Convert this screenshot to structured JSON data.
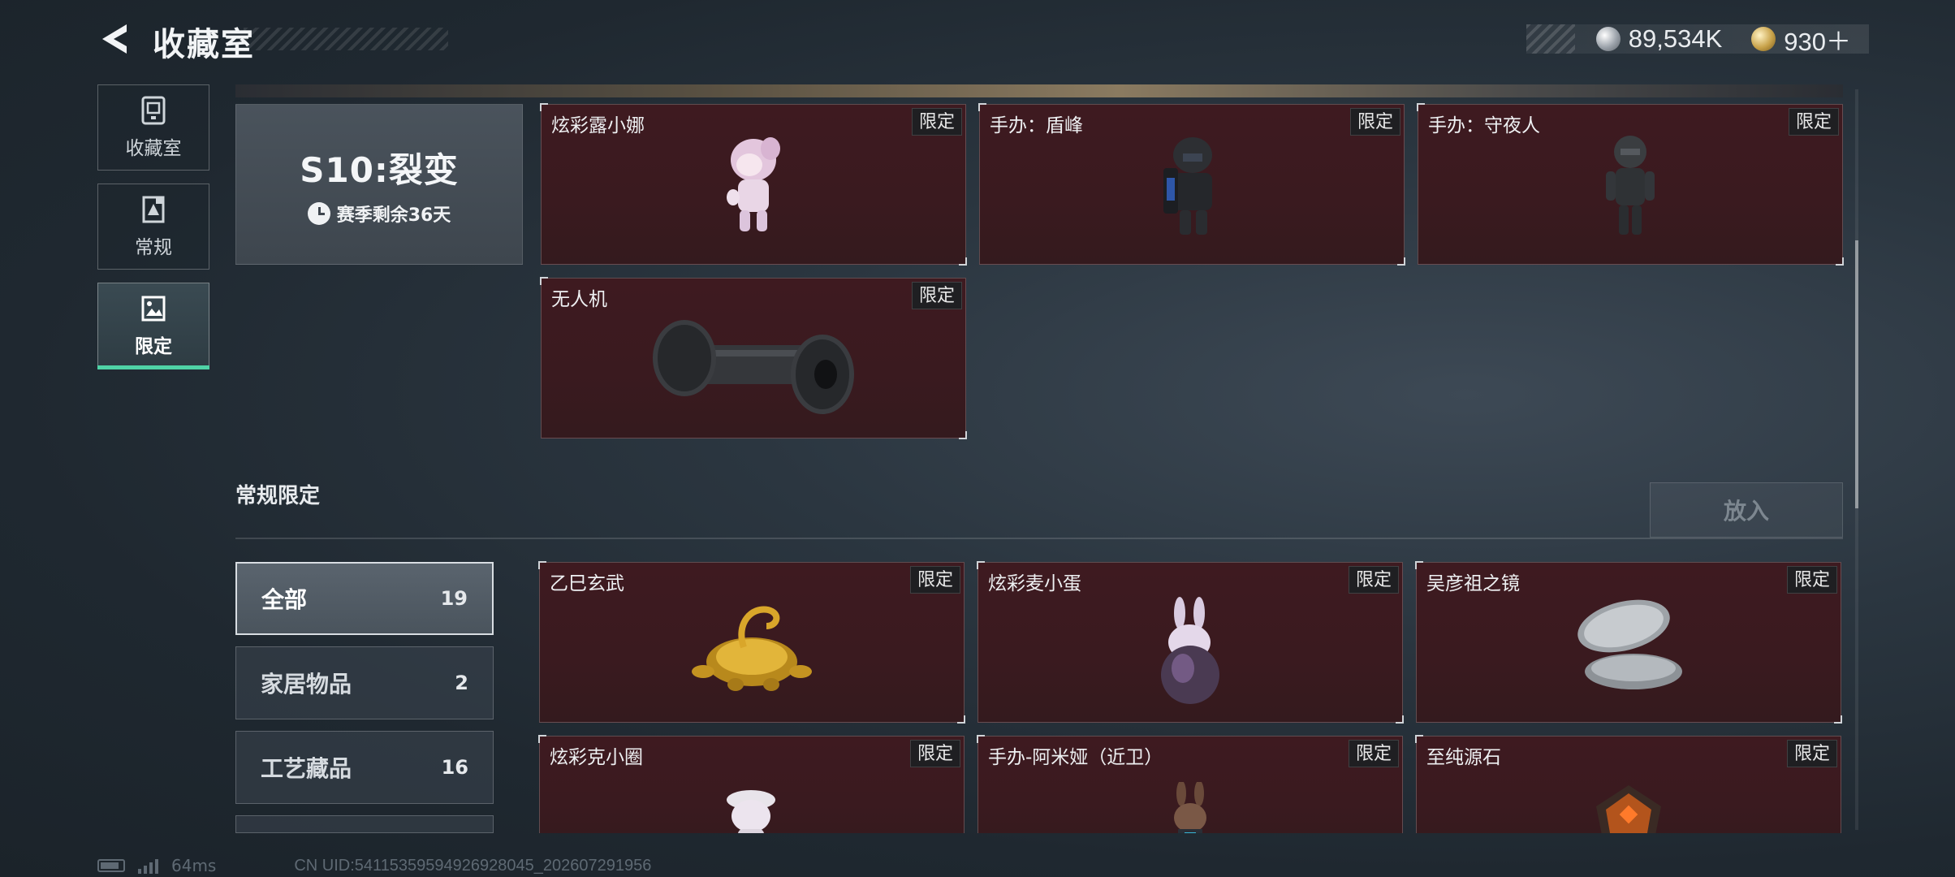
{
  "header": {
    "title": "收藏室",
    "currency": [
      {
        "icon": "silver-coin-icon",
        "value": "89,534K"
      },
      {
        "icon": "gold-coin-icon",
        "value": "930＋"
      }
    ]
  },
  "nav": {
    "items": [
      {
        "label": "收藏室",
        "icon": "collection-box-icon",
        "active": false
      },
      {
        "label": "常规",
        "icon": "regular-doc-icon",
        "active": false
      },
      {
        "label": "限定",
        "icon": "limited-image-icon",
        "active": true
      }
    ]
  },
  "season": {
    "name": "S10:裂变",
    "remaining": "赛季剩余36天"
  },
  "season_items": [
    {
      "name": "炫彩露小娜",
      "tag": "限定",
      "art": "figure-pink-girl"
    },
    {
      "name": "手办：盾峰",
      "tag": "限定",
      "art": "figure-armored-soldier"
    },
    {
      "name": "手办：守夜人",
      "tag": "限定",
      "art": "figure-dark-soldier"
    },
    {
      "name": "无人机",
      "tag": "限定",
      "art": "drone-roller"
    }
  ],
  "section": {
    "title": "常规限定",
    "put_button": "放入"
  },
  "categories": [
    {
      "label": "全部",
      "count": "19",
      "active": true
    },
    {
      "label": "家居物品",
      "count": "2",
      "active": false
    },
    {
      "label": "工艺藏品",
      "count": "16",
      "active": false
    }
  ],
  "regular_items": [
    {
      "name": "乙巳玄武",
      "tag": "限定",
      "art": "golden-tortoise-snake"
    },
    {
      "name": "炫彩麦小蛋",
      "tag": "限定",
      "art": "bunny-egg"
    },
    {
      "name": "吴彦祖之镜",
      "tag": "限定",
      "art": "compact-mirror"
    },
    {
      "name": "炫彩克小圈",
      "tag": "限定",
      "art": "figure-white-hat"
    },
    {
      "name": "手办-阿米娅（近卫）",
      "tag": "限定",
      "art": "figure-amiya"
    },
    {
      "name": "至纯源石",
      "tag": "限定",
      "art": "originium-stone"
    }
  ],
  "status": {
    "ping": "64ms",
    "uid": "CN UID:54115359594926928045_202607291956"
  }
}
